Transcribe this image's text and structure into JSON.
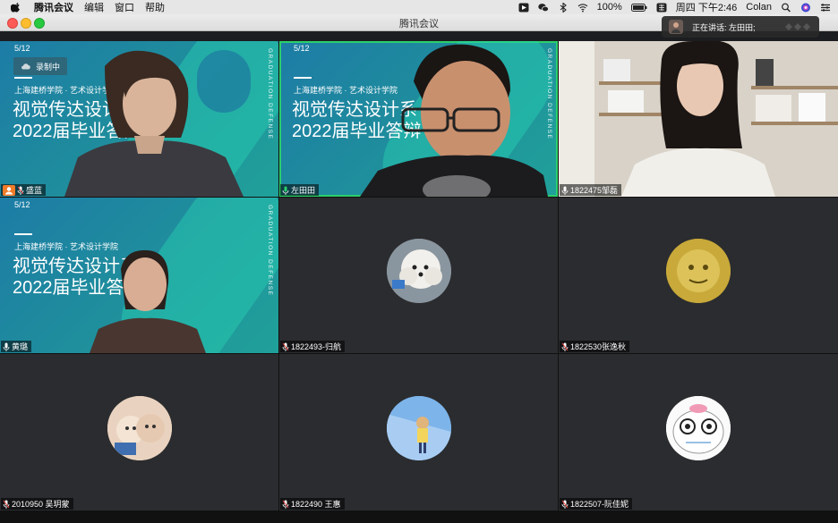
{
  "menubar": {
    "app_name": "腾讯会议",
    "menus": [
      "编辑",
      "窗口",
      "帮助"
    ],
    "status": {
      "battery": "100%",
      "datetime": "周四 下午2:46",
      "user": "Colan"
    }
  },
  "window": {
    "title": "腾讯会议"
  },
  "recording_label": "录制中",
  "speaking": {
    "label": "正在讲话: 左田田;"
  },
  "slide": {
    "date": "5/12",
    "school": "上海建桥学院 · 艺术设计学院",
    "title_line1": "视觉传达设计系",
    "title_line2": "2022届毕业答辩",
    "vertical_text": "GRADUATION DEFENSE"
  },
  "participants": [
    {
      "name": "盛蓝"
    },
    {
      "name": "左田田"
    },
    {
      "name": "1822475邹磊"
    },
    {
      "name": "黄璐"
    },
    {
      "name": "1822493-归航"
    },
    {
      "name": "1822530张逸秋"
    },
    {
      "name": "2010950 吴玥蒙"
    },
    {
      "name": "1822490 王惠"
    },
    {
      "name": "1822507-阮佳妮"
    }
  ],
  "colors": {
    "active_speaker": "#2ccf6b",
    "slide_teal": "#1f8c9d",
    "tile_bg": "#2b2c2f"
  }
}
